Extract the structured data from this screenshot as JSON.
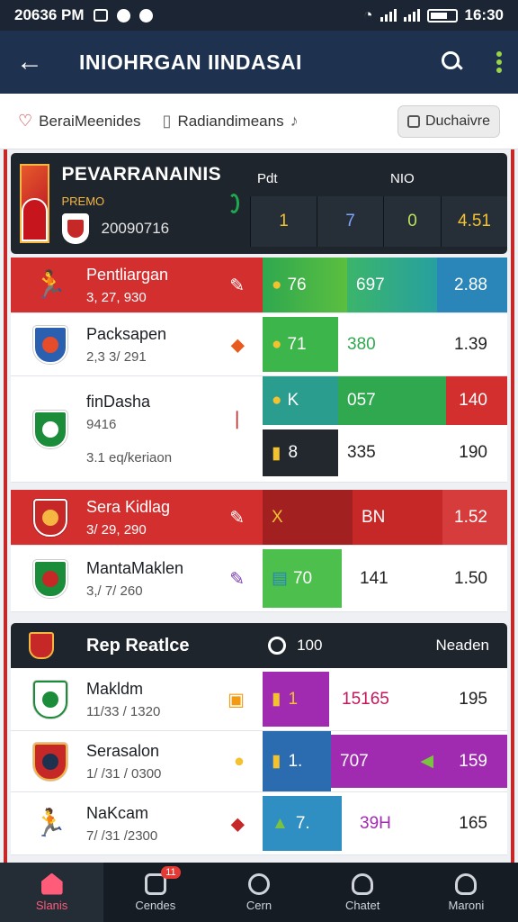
{
  "status_bar": {
    "time_left": "20636 PM",
    "time_right": "16:30"
  },
  "app_bar": {
    "title": "INIOHRGAN IINDASAI"
  },
  "filters": {
    "items": [
      {
        "label": "BeraiMeenides"
      },
      {
        "label": "Radiandimeans"
      }
    ],
    "button_label": "Duchaivre"
  },
  "featured": {
    "name": "PEVARRANAINIS",
    "sub": "PREMO",
    "date": "20090716",
    "stat_headers": [
      "Pdt",
      "",
      "NIO",
      ""
    ],
    "stat_values": [
      "1",
      "7",
      "0",
      "4.51"
    ]
  },
  "match_rows": [
    {
      "name": "Pentliargan",
      "sub": "3, 27, 930",
      "v1": "76",
      "v2": "697",
      "v3": "2.88"
    },
    {
      "name": "Packsapen",
      "sub": "2,3 3/ 291",
      "v1": "71",
      "v2": "380",
      "v3": "1.39"
    },
    {
      "name": "finDasha",
      "sub": "9416",
      "v1": "K",
      "v2": "057",
      "v3": "140",
      "sub2": "3.1 eq/keriaon"
    },
    {
      "name": "",
      "sub": "",
      "v1": "8",
      "v2": "335",
      "v3": "190"
    },
    {
      "name": "Sera Kidlag",
      "sub": "3/ 29, 290",
      "v1": "X",
      "v2": "BN",
      "v3": "1.52"
    },
    {
      "name": "MantaMaklen",
      "sub": "3,/ 7/ 260",
      "v1": "70",
      "v2": "141",
      "v3": "1.50"
    }
  ],
  "section": {
    "title": "Rep Reatlce",
    "count": "100",
    "label": "Neaden"
  },
  "section_rows": [
    {
      "name": "Makldm",
      "sub": "11/33 / 1320",
      "v1": "1",
      "v2": "15165",
      "v3": "195"
    },
    {
      "name": "Serasalon",
      "sub": "1/ /31 / 0300",
      "v1": "1.",
      "v2": "707",
      "v3": "159"
    },
    {
      "name": "NaKcam",
      "sub": "7/ /31 /2300",
      "v1": "7.",
      "v2": "39H",
      "v3": "165"
    }
  ],
  "bottom_nav": [
    {
      "label": "Slanis",
      "badge": ""
    },
    {
      "label": "Cendes",
      "badge": "11"
    },
    {
      "label": "Cern",
      "badge": ""
    },
    {
      "label": "Chatet",
      "badge": ""
    },
    {
      "label": "Maroni",
      "badge": ""
    }
  ],
  "colors": {
    "accent": "#c62828",
    "navy": "#1e3250",
    "green": "#2fa84f",
    "teal": "#2a9d8f",
    "purple": "#a12bb0",
    "blue": "#2b6cb0"
  }
}
